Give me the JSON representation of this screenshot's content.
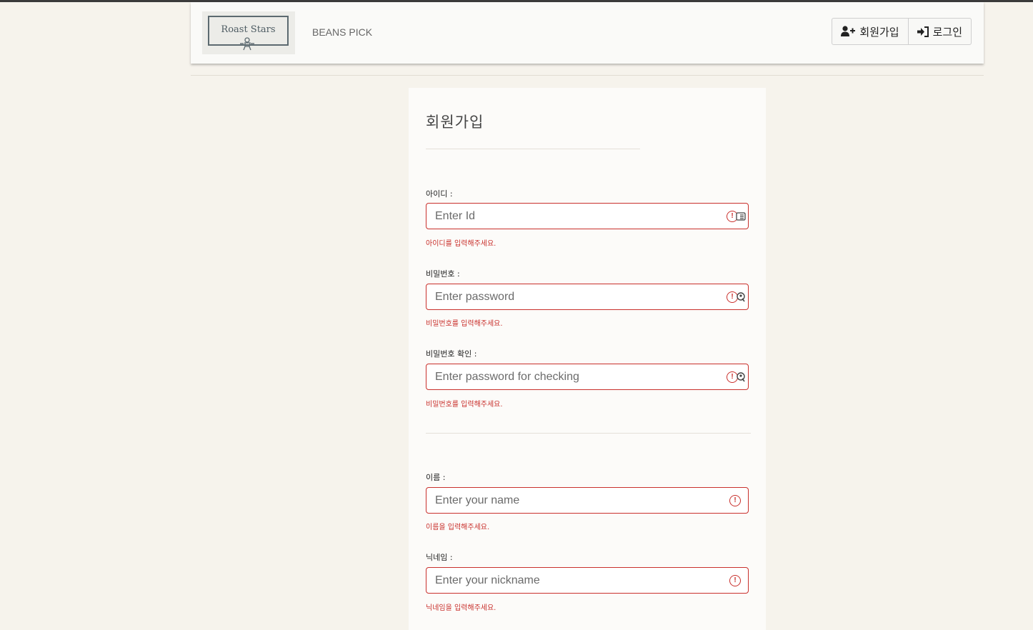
{
  "header": {
    "logo_text": "Roast Stars",
    "brand": "BEANS PICK",
    "signup_label": "회원가입",
    "login_label": "로그인"
  },
  "form": {
    "title": "회원가입",
    "fields": [
      {
        "label": "아이디 :",
        "placeholder": "Enter Id",
        "error": "아이디를 입력해주세요."
      },
      {
        "label": "비밀번호 :",
        "placeholder": "Enter password",
        "error": "비밀번호를 입력해주세요."
      },
      {
        "label": "비밀번호 확인 :",
        "placeholder": "Enter password for checking",
        "error": "비밀번호를 입력해주세요."
      },
      {
        "label": "이름 :",
        "placeholder": "Enter your name",
        "error": "이름을 입력해주세요."
      },
      {
        "label": "닉네임 :",
        "placeholder": "Enter your nickname",
        "error": "닉네임을 입력해주세요."
      }
    ]
  },
  "colors": {
    "error": "#c9302c",
    "background": "#f6f3ec",
    "card": "#fcfbf9"
  },
  "icons": {
    "signup": "user-plus-icon",
    "login": "sign-in-icon",
    "field_error": "exclamation-circle-icon",
    "id_autofill": "id-card-icon",
    "password_autofill": "key-icon"
  }
}
